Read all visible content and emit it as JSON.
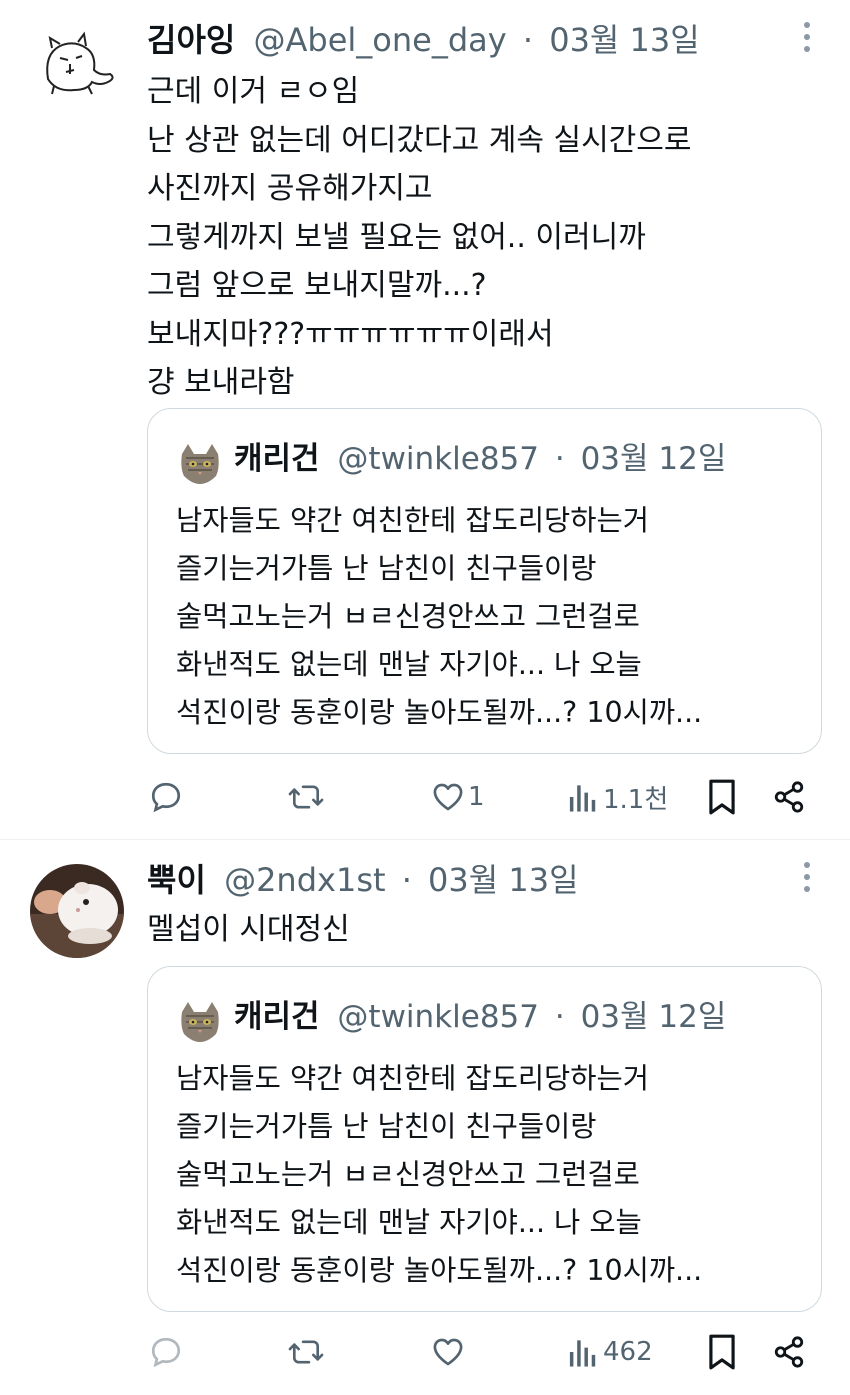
{
  "tweets": [
    {
      "name": "김아잉",
      "handle": "@Abel_one_day",
      "date": "03월 13일",
      "text": "근데 이거 ㄹㅇ임\n난 상관 없는데 어디갔다고 계속 실시간으로\n사진까지 공유해가지고\n그렇게까지 보낼 필요는 없어.. 이러니까\n그럼 앞으로 보내지말까...?\n보내지마???ㅠㅠㅠㅠㅠㅠ이래서\n걍 보내라함",
      "quote": {
        "name": "캐리건",
        "handle": "@twinkle857",
        "date": "03월 12일",
        "text": "남자들도 약간 여친한테 잡도리당하는거\n즐기는거가틈 난 남친이 친구들이랑\n술먹고노는거 ㅂㄹ신경안쓰고 그런걸로\n화낸적도 없는데 맨날 자기야... 나 오늘\n석진이랑 동훈이랑 놀아도될까...? 10시까..."
      },
      "actions": {
        "replies": "",
        "retweets": "",
        "likes": "1",
        "views": "1.1천"
      }
    },
    {
      "name": "뿍이",
      "handle": "@2ndx1st",
      "date": "03월 13일",
      "text": "멜섭이 시대정신",
      "quote": {
        "name": "캐리건",
        "handle": "@twinkle857",
        "date": "03월 12일",
        "text": "남자들도 약간 여친한테 잡도리당하는거\n즐기는거가틈 난 남친이 친구들이랑\n술먹고노는거 ㅂㄹ신경안쓰고 그런걸로\n화낸적도 없는데 맨날 자기야... 나 오늘\n석진이랑 동훈이랑 놀아도될까...? 10시까..."
      },
      "actions": {
        "replies": "",
        "retweets": "",
        "likes": "",
        "views": "462"
      }
    }
  ],
  "separator": "·",
  "icons": {
    "more": "more-vertical-icon",
    "reply": "reply-icon",
    "retweet": "retweet-icon",
    "like": "heart-icon",
    "views": "views-bar-chart-icon",
    "bookmark": "bookmark-icon",
    "share": "share-icon"
  },
  "colors": {
    "text": "#0f1419",
    "secondary": "#536471",
    "border": "#cfd9de"
  }
}
